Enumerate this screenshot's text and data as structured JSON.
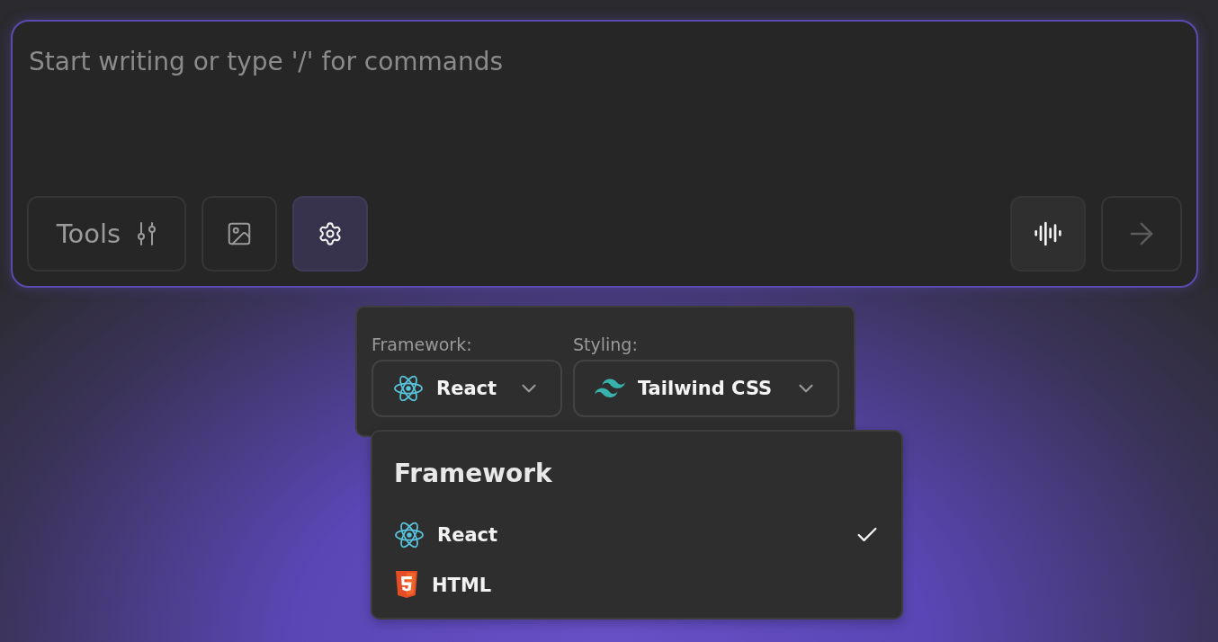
{
  "composer": {
    "placeholder": "Start writing or type '/' for commands",
    "left_buttons": [
      {
        "kind": "tools",
        "label": "Tools",
        "selected": false
      },
      {
        "kind": "image",
        "selected": false
      },
      {
        "kind": "settings",
        "selected": true
      }
    ],
    "right_buttons": [
      {
        "kind": "voice",
        "disabled": false
      },
      {
        "kind": "send",
        "disabled": true
      }
    ]
  },
  "settings_popover": {
    "fields": [
      {
        "label": "Framework:",
        "value": "React",
        "kind": "react"
      },
      {
        "label": "Styling:",
        "value": "Tailwind CSS",
        "kind": "tailwind"
      }
    ]
  },
  "menu": {
    "title": "Framework",
    "items": [
      {
        "label": "React",
        "kind": "react",
        "selected": true
      },
      {
        "label": "HTML",
        "kind": "html5",
        "selected": false
      }
    ]
  }
}
